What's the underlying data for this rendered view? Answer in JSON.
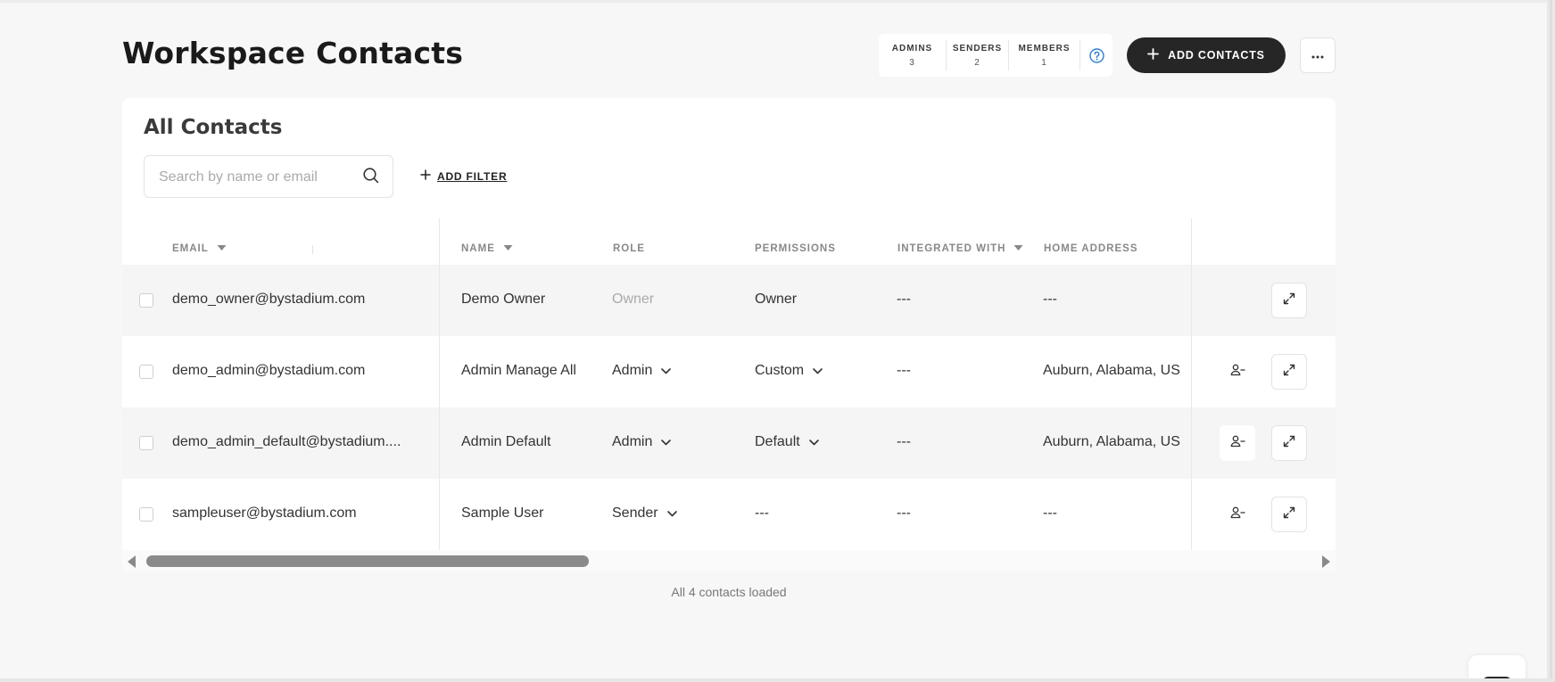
{
  "header": {
    "title": "Workspace Contacts",
    "stats": [
      {
        "label": "ADMINS",
        "value": "3"
      },
      {
        "label": "SENDERS",
        "value": "2"
      },
      {
        "label": "MEMBERS",
        "value": "1"
      }
    ],
    "add_contacts_label": "ADD CONTACTS"
  },
  "card": {
    "title": "All Contacts",
    "search_placeholder": "Search by name or email",
    "add_filter_label": "ADD FILTER"
  },
  "table": {
    "columns": {
      "email": "EMAIL",
      "name": "NAME",
      "role": "ROLE",
      "permissions": "PERMISSIONS",
      "integrated_with": "INTEGRATED WITH",
      "home_address": "HOME ADDRESS"
    },
    "rows": [
      {
        "email": "demo_owner@bystadium.com",
        "name": "Demo Owner",
        "role": "Owner",
        "permissions": "Owner",
        "integrated_with": "---",
        "home_address": "---"
      },
      {
        "email": "demo_admin@bystadium.com",
        "name": "Admin Manage All",
        "role": "Admin",
        "permissions": "Custom",
        "integrated_with": "---",
        "home_address": "Auburn, Alabama, US"
      },
      {
        "email": "demo_admin_default@bystadium....",
        "name": "Admin Default",
        "role": "Admin",
        "permissions": "Default",
        "integrated_with": "---",
        "home_address": "Auburn, Alabama, US"
      },
      {
        "email": "sampleuser@bystadium.com",
        "name": "Sample User",
        "role": "Sender",
        "permissions": "---",
        "integrated_with": "---",
        "home_address": "---"
      }
    ]
  },
  "footer": {
    "status": "All 4 contacts loaded"
  },
  "colors": {
    "accent": "#262626",
    "help_blue": "#2d7fd0"
  }
}
